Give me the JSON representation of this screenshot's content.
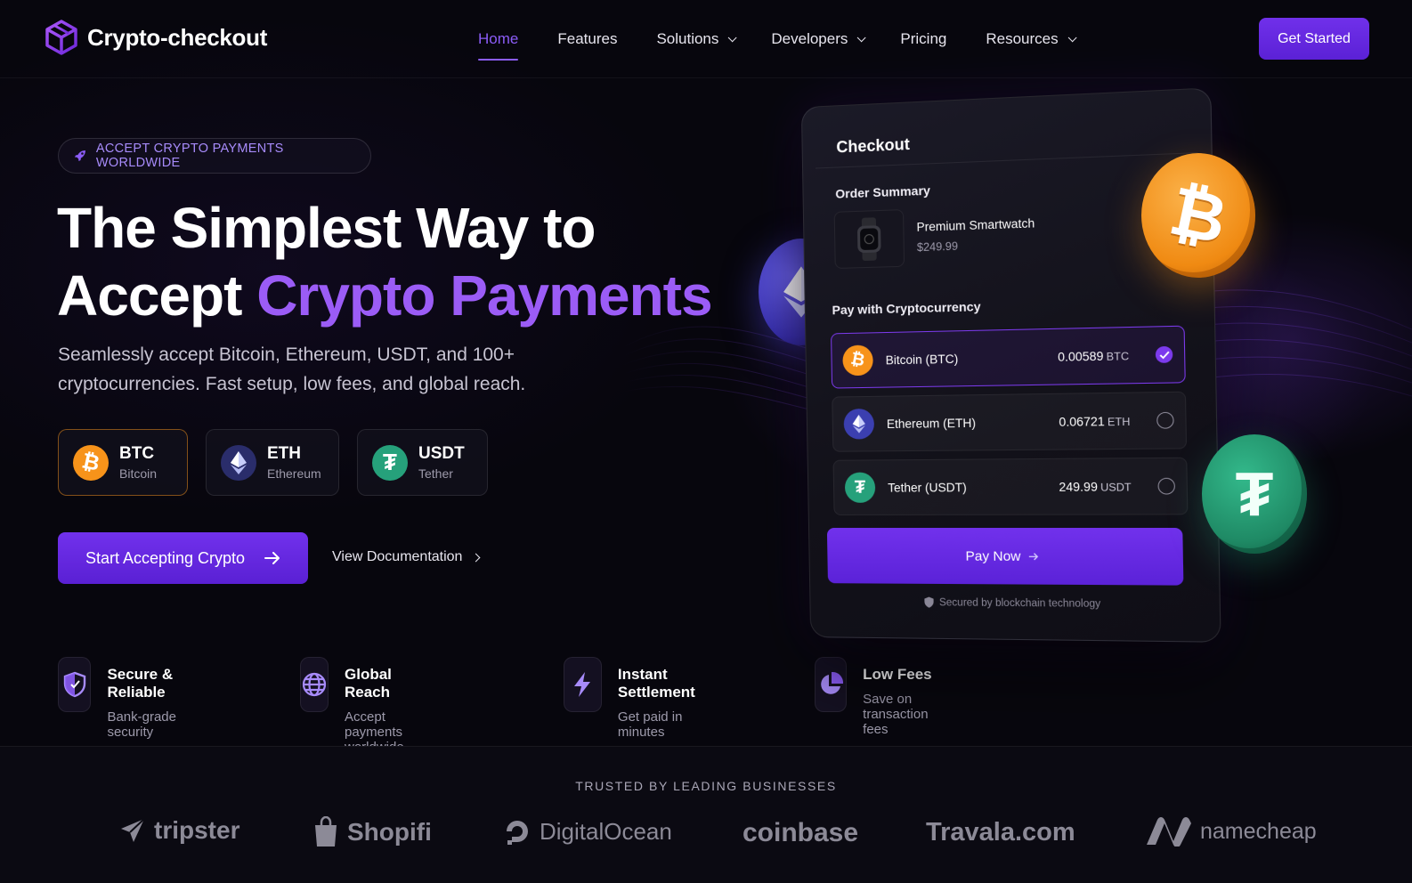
{
  "brand": {
    "name": "Crypto-checkout"
  },
  "nav": {
    "items": [
      {
        "label": "Home",
        "active": true,
        "dropdown": false
      },
      {
        "label": "Features",
        "active": false,
        "dropdown": false
      },
      {
        "label": "Solutions",
        "active": false,
        "dropdown": true
      },
      {
        "label": "Developers",
        "active": false,
        "dropdown": true
      },
      {
        "label": "Pricing",
        "active": false,
        "dropdown": false
      },
      {
        "label": "Resources",
        "active": false,
        "dropdown": true
      }
    ],
    "cta": "Get Started"
  },
  "hero": {
    "badge": "ACCEPT CRYPTO PAYMENTS WORLDWIDE",
    "title_line1": "The Simplest Way to",
    "title_line2_plain": "Accept",
    "title_line2_accent": "Crypto Payments",
    "subtitle": "Seamlessly accept Bitcoin, Ethereum, USDT, and 100+ cryptocurrencies. Fast setup, low fees, and global reach.",
    "coins": [
      {
        "symbol": "BTC",
        "name": "Bitcoin",
        "icon": "bitcoin-icon",
        "color": "#f7931a"
      },
      {
        "symbol": "ETH",
        "name": "Ethereum",
        "icon": "ethereum-icon",
        "color": "#4c4ac8"
      },
      {
        "symbol": "USDT",
        "name": "Tether",
        "icon": "tether-icon",
        "color": "#26a17b"
      }
    ],
    "primary_cta": "Start Accepting Crypto",
    "secondary_cta": "View Documentation"
  },
  "features": [
    {
      "title": "Secure & Reliable",
      "subtitle": "Bank-grade security",
      "icon": "shield-icon"
    },
    {
      "title": "Global Reach",
      "subtitle": "Accept payments worldwide",
      "icon": "globe-icon"
    },
    {
      "title": "Instant Settlement",
      "subtitle": "Get paid in minutes",
      "icon": "lightning-icon"
    },
    {
      "title": "Low Fees",
      "subtitle": "Save on transaction fees",
      "icon": "pie-chart-icon"
    }
  ],
  "checkout": {
    "title": "Checkout",
    "order_summary": "Order Summary",
    "product": {
      "name": "Premium Smartwatch",
      "price": "$249.99"
    },
    "pay_with": "Pay with Cryptocurrency",
    "options": [
      {
        "name": "Bitcoin (BTC)",
        "amount": "0.00589",
        "unit": "BTC",
        "selected": true
      },
      {
        "name": "Ethereum (ETH)",
        "amount": "0.06721",
        "unit": "ETH",
        "selected": false
      },
      {
        "name": "Tether (USDT)",
        "amount": "249.99",
        "unit": "USDT",
        "selected": false
      }
    ],
    "pay_button": "Pay Now",
    "secured": "Secured by blockchain technology"
  },
  "trusted": {
    "label": "TRUSTED BY LEADING BUSINESSES",
    "brands": [
      "tripster",
      "Shopifi",
      "DigitalOcean",
      "coinbase",
      "Travala.com",
      "namecheap"
    ]
  },
  "colors": {
    "accent": "#7c3aed",
    "accent_text": "#9b5cf6",
    "bitcoin": "#f7931a",
    "ethereum": "#4c4ac8",
    "tether": "#26a17b"
  }
}
